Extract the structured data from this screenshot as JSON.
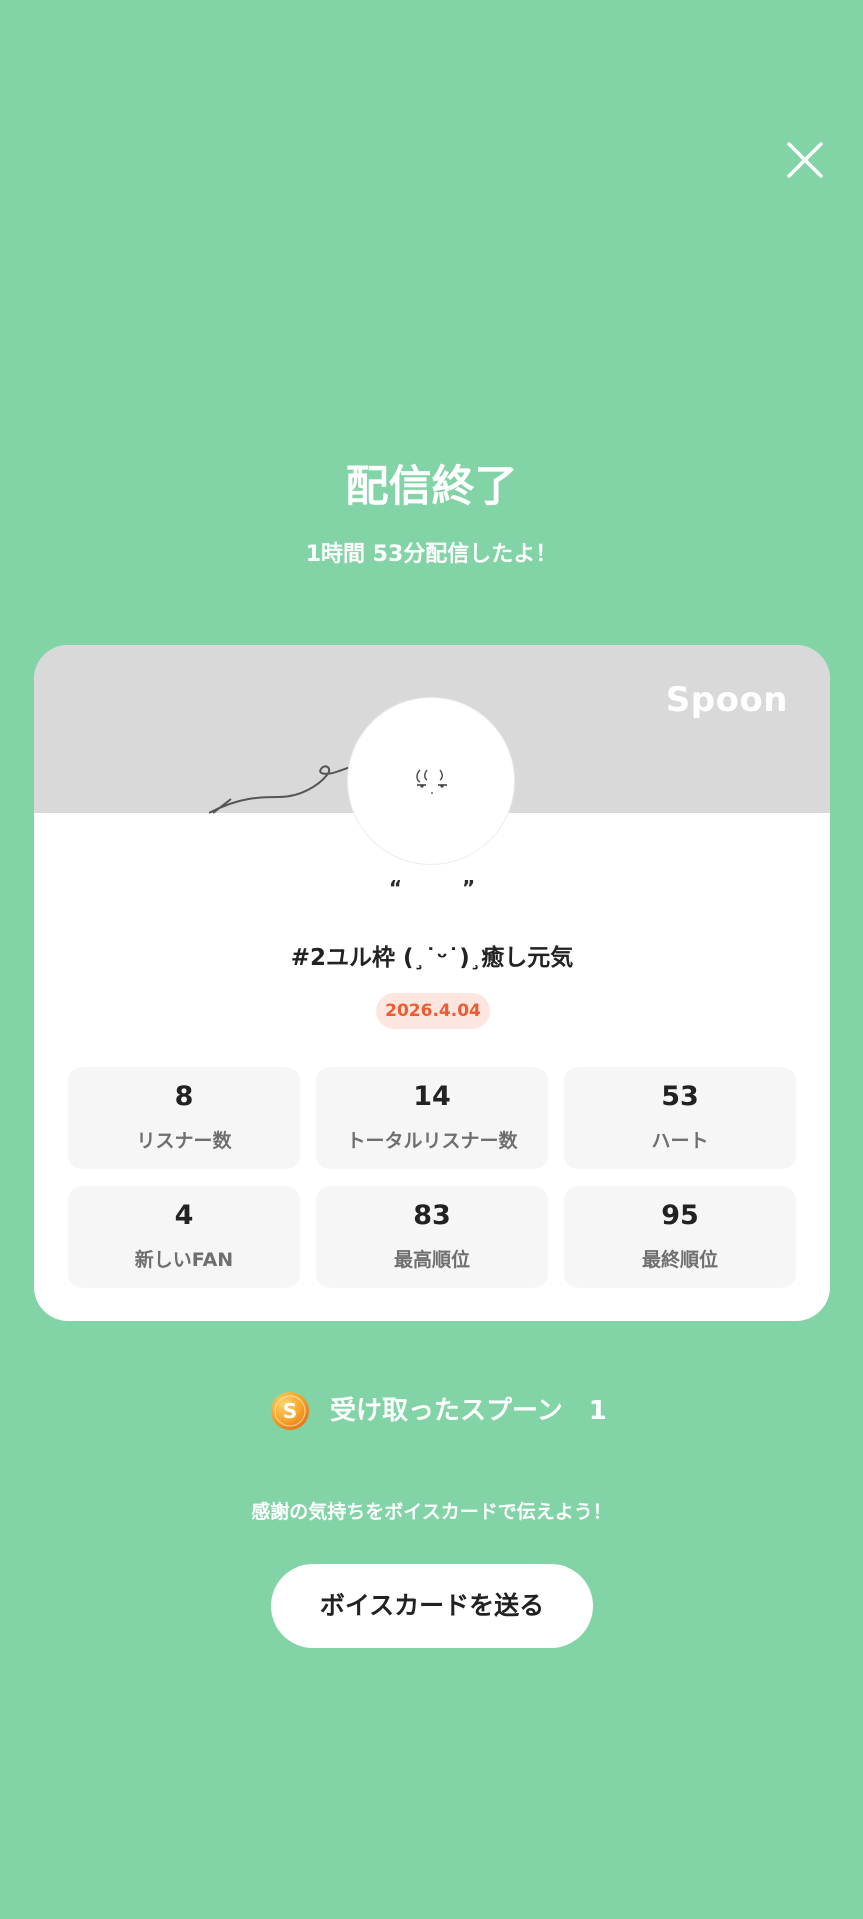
{
  "header": {
    "title": "配信終了",
    "subtitle": "1時間 53分配信したよ！"
  },
  "card": {
    "brand": "Spoon",
    "nickname": "“　　　”",
    "live_title": "#2ユル枠 (¸˙ᵕ˙)¸癒し元気",
    "date": "2026.4.04",
    "stats": [
      {
        "value": "8",
        "label": "リスナー数"
      },
      {
        "value": "14",
        "label": "トータルリスナー数"
      },
      {
        "value": "53",
        "label": "ハート"
      },
      {
        "value": "4",
        "label": "新しいFAN"
      },
      {
        "value": "83",
        "label": "最高順位"
      },
      {
        "value": "95",
        "label": "最終順位"
      }
    ]
  },
  "spoons": {
    "label": "受け取ったスプーン　1",
    "coin_glyph": "S"
  },
  "voice_card": {
    "prompt": "感謝の気持ちをボイスカードで伝えよう！",
    "button_label": "ボイスカードを送る"
  },
  "colors": {
    "background": "#82d4a6",
    "card_header": "#d9d9d9",
    "badge_bg": "#fde6df",
    "badge_text": "#ee5b2e",
    "stat_bg": "#f6f6f6",
    "coin": "#f29a20"
  },
  "icons": {
    "close": "close-icon",
    "coin": "spoon-coin-icon"
  }
}
